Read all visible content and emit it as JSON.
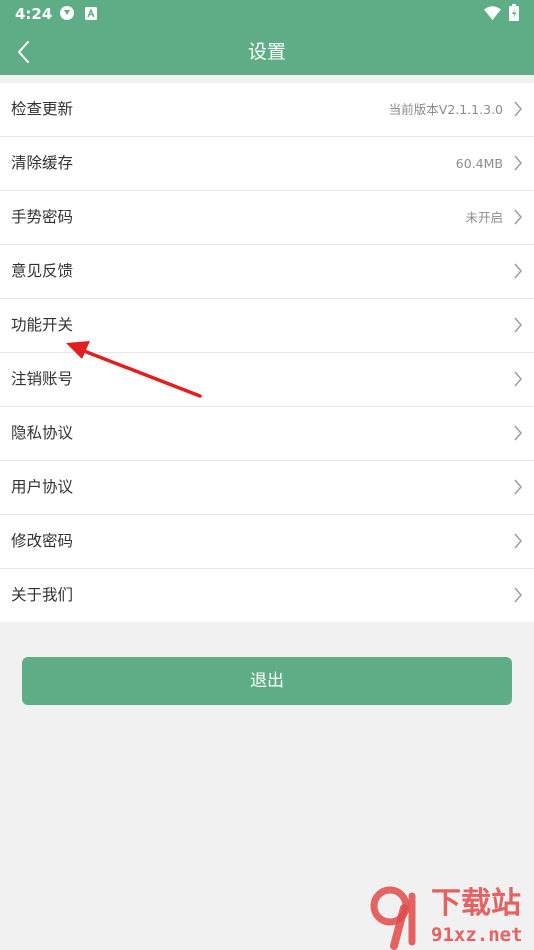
{
  "status_bar": {
    "time": "4:24"
  },
  "header": {
    "title": "设置",
    "back_icon": "chevron-left-icon"
  },
  "settings": {
    "items": [
      {
        "label": "检查更新",
        "value": "当前版本V2.1.1.3.0"
      },
      {
        "label": "清除缓存",
        "value": "60.4MB"
      },
      {
        "label": "手势密码",
        "value": "未开启"
      },
      {
        "label": "意见反馈",
        "value": ""
      },
      {
        "label": "功能开关",
        "value": ""
      },
      {
        "label": "注销账号",
        "value": ""
      },
      {
        "label": "隐私协议",
        "value": ""
      },
      {
        "label": "用户协议",
        "value": ""
      },
      {
        "label": "修改密码",
        "value": ""
      },
      {
        "label": "关于我们",
        "value": ""
      }
    ]
  },
  "logout_label": "退出",
  "watermark": {
    "title": "下载站",
    "url": "91xz.net"
  },
  "colors": {
    "accent": "#5ead87",
    "background": "#f1f1f1",
    "annotation": "#e02020",
    "watermark": "#e24a4a"
  }
}
